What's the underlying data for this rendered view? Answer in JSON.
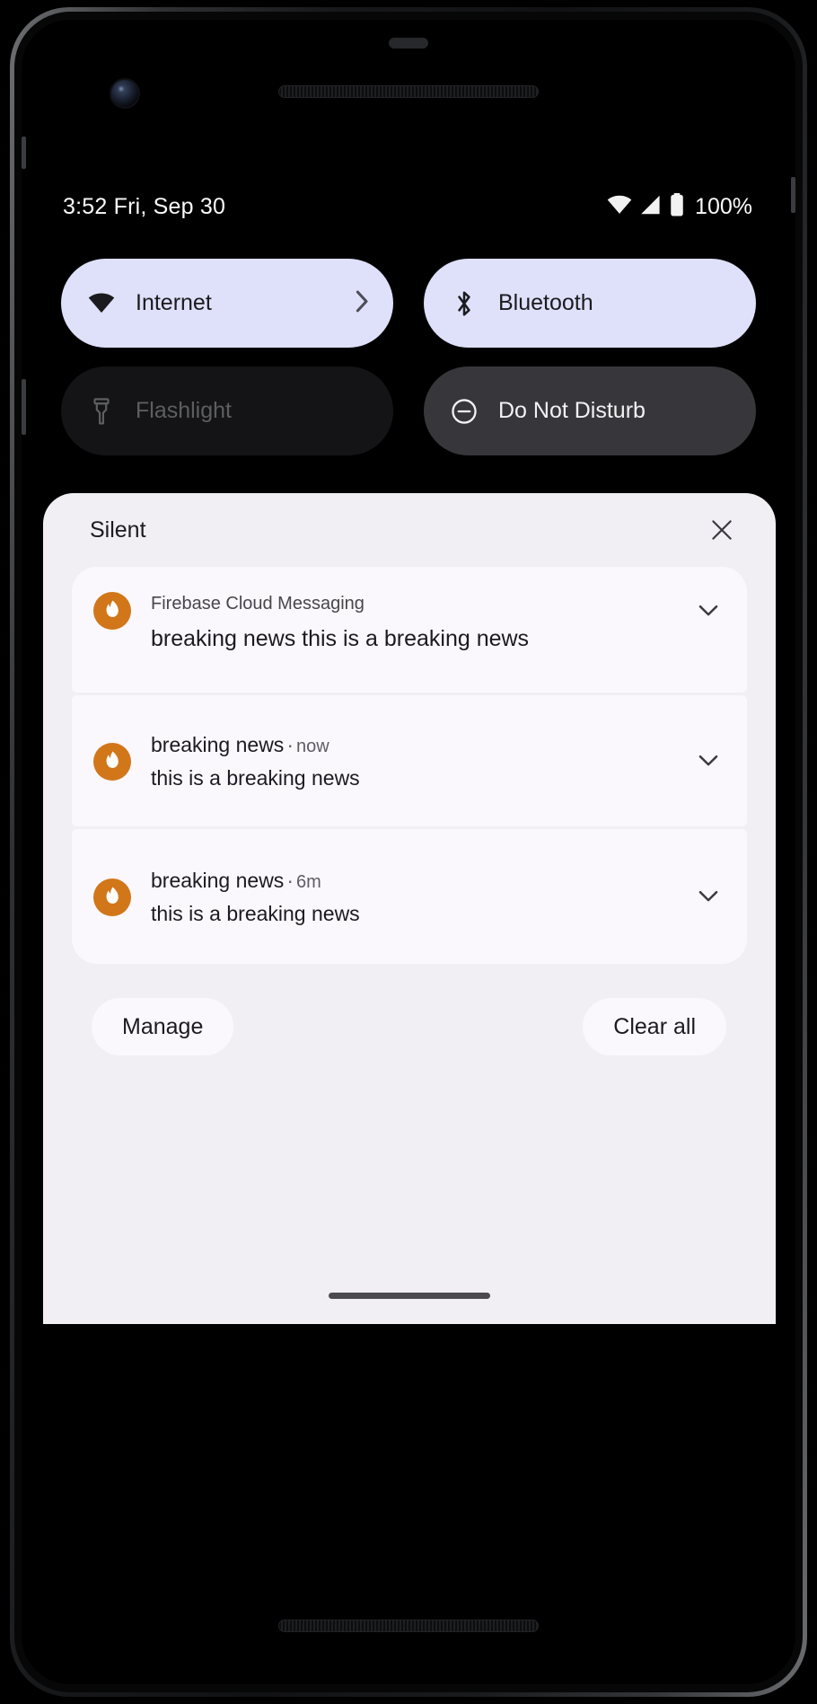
{
  "status_bar": {
    "clock": "3:52 Fri, Sep 30",
    "battery_percent": "100%",
    "icons": [
      "wifi-icon",
      "signal-icon",
      "battery-icon"
    ]
  },
  "quick_settings": {
    "tiles": [
      {
        "label": "Internet",
        "icon": "wifi-icon",
        "state": "active",
        "has_chevron": true
      },
      {
        "label": "Bluetooth",
        "icon": "bluetooth-icon",
        "state": "active",
        "has_chevron": false
      },
      {
        "label": "Flashlight",
        "icon": "flashlight-icon",
        "state": "inactive-dark",
        "has_chevron": false
      },
      {
        "label": "Do Not Disturb",
        "icon": "do-not-disturb-icon",
        "state": "semi",
        "has_chevron": false
      }
    ]
  },
  "shade": {
    "section_label": "Silent",
    "close_icon": "close-icon",
    "notifications": [
      {
        "app_name": "Firebase Cloud Messaging",
        "title": "",
        "time": "",
        "text": "breaking news this is a breaking news",
        "avatar_icon": "firebase-flame-icon",
        "expand_icon": "chevron-down-icon"
      },
      {
        "app_name": "",
        "title": "breaking news",
        "separator": "·",
        "time": "now",
        "text": "this is a breaking news",
        "avatar_icon": "firebase-flame-icon",
        "expand_icon": "chevron-down-icon"
      },
      {
        "app_name": "",
        "title": "breaking news",
        "separator": "·",
        "time": "6m",
        "text": "this is a breaking news",
        "avatar_icon": "firebase-flame-icon",
        "expand_icon": "chevron-down-icon"
      }
    ],
    "manage_label": "Manage",
    "clear_all_label": "Clear all"
  },
  "colors": {
    "tile_active_bg": "#dfe0f9",
    "tile_semi_bg": "#37373b",
    "tile_inactive_bg": "#141416",
    "shade_bg": "#f1eff4",
    "card_bg": "#fbf8fd",
    "firebase_orange": "#d2761a"
  }
}
